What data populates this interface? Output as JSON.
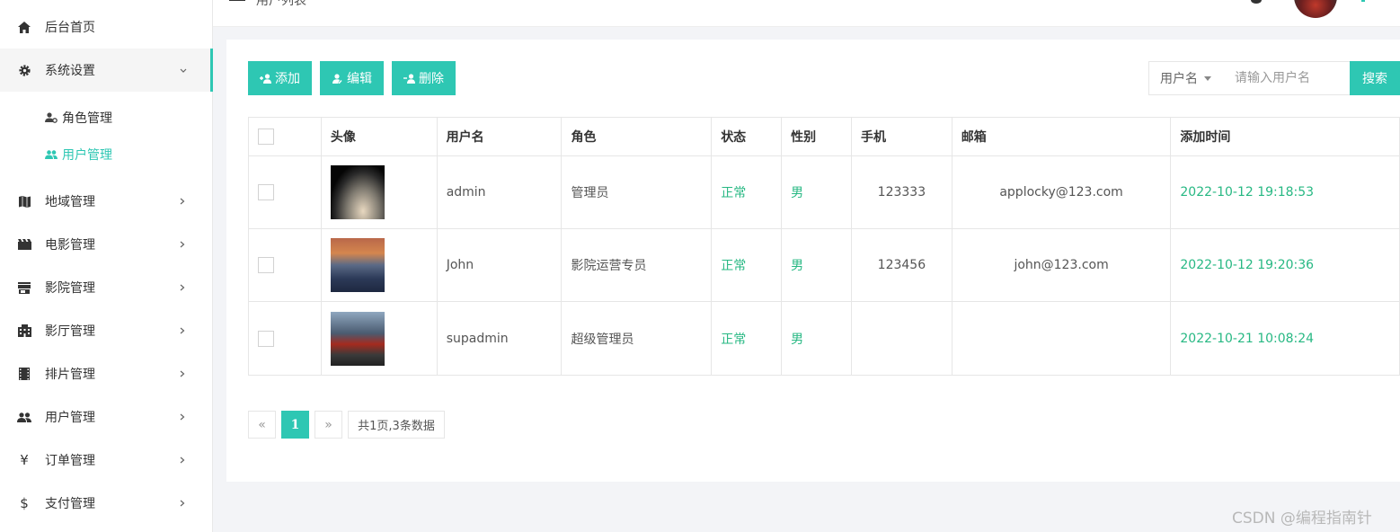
{
  "topbar": {
    "breadcrumb": "用户列表"
  },
  "sidebar": {
    "items": [
      {
        "label": "后台首页",
        "icon": "home-icon"
      },
      {
        "label": "系统设置",
        "icon": "gear-icon",
        "expanded": true,
        "children": [
          {
            "label": "角色管理",
            "icon": "user-role-icon"
          },
          {
            "label": "用户管理",
            "icon": "users-icon"
          }
        ]
      },
      {
        "label": "地域管理",
        "icon": "map-icon"
      },
      {
        "label": "电影管理",
        "icon": "film-icon"
      },
      {
        "label": "影院管理",
        "icon": "store-icon"
      },
      {
        "label": "影厅管理",
        "icon": "building-icon"
      },
      {
        "label": "排片管理",
        "icon": "schedule-icon"
      },
      {
        "label": "用户管理",
        "icon": "users-icon"
      },
      {
        "label": "订单管理",
        "icon": "yen-icon"
      },
      {
        "label": "支付管理",
        "icon": "dollar-icon"
      }
    ]
  },
  "toolbar": {
    "add_label": "添加",
    "edit_label": "编辑",
    "delete_label": "删除"
  },
  "search": {
    "field_label": "用户名",
    "placeholder": "请输入用户名",
    "button_label": "搜索"
  },
  "table": {
    "headers": [
      "头像",
      "用户名",
      "角色",
      "状态",
      "性别",
      "手机",
      "邮箱",
      "添加时间"
    ],
    "rows": [
      {
        "username": "admin",
        "role": "管理员",
        "status": "正常",
        "gender": "男",
        "phone": "123333",
        "email": "applocky@123.com",
        "created": "2022-10-12 19:18:53"
      },
      {
        "username": "John",
        "role": "影院运营专员",
        "status": "正常",
        "gender": "男",
        "phone": "123456",
        "email": "john@123.com",
        "created": "2022-10-12 19:20:36"
      },
      {
        "username": "supadmin",
        "role": "超级管理员",
        "status": "正常",
        "gender": "男",
        "phone": "",
        "email": "",
        "created": "2022-10-21 10:08:24"
      }
    ]
  },
  "pager": {
    "prev": "«",
    "current": "1",
    "next": "»",
    "info": "共1页,3条数据"
  },
  "watermark": "CSDN @编程指南针",
  "colors": {
    "accent": "#2ec7b3",
    "status_green": "#27b883"
  }
}
